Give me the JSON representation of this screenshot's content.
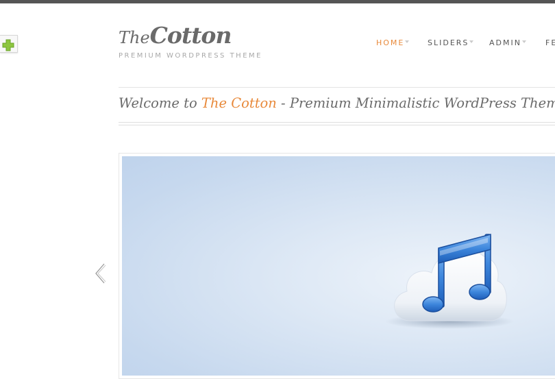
{
  "header": {
    "logo_prefix": "The",
    "logo_main": "Cotton",
    "tagline": "PREMIUM WORDPRESS THEME"
  },
  "nav": {
    "items": [
      {
        "label": "HOME",
        "active": true,
        "has_dropdown": true
      },
      {
        "label": "SLIDERS",
        "active": false,
        "has_dropdown": true
      },
      {
        "label": "ADMIN",
        "active": false,
        "has_dropdown": true
      },
      {
        "label": "FE",
        "active": false,
        "has_dropdown": false
      }
    ]
  },
  "welcome": {
    "prefix": "Welcome to ",
    "highlight": "The Cotton",
    "suffix": " - Premium Minimalistic WordPress Theme"
  },
  "slider": {
    "slide_icon": "music-note-cloud-icon",
    "prev_icon": "chevron-left-icon"
  },
  "side_toggle": {
    "icon": "plus-icon"
  },
  "colors": {
    "accent": "#e8893a",
    "text": "#6a6a6a",
    "topbar": "#555555",
    "plus": "#8dc63f"
  }
}
